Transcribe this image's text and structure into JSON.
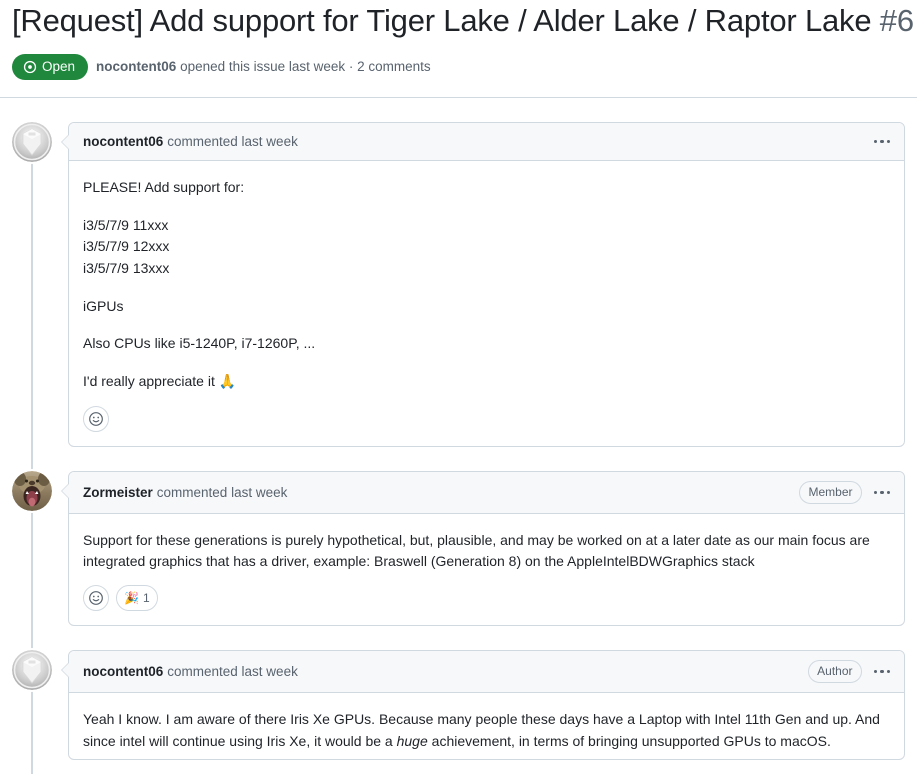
{
  "issue": {
    "title": "[Request] Add support for Tiger Lake / Alder Lake / Raptor Lake",
    "number": "#6",
    "state_label": "Open",
    "state_color": "#1f883d",
    "meta_author": "nocontent06",
    "meta_text": "opened this issue last week · 2 comments"
  },
  "comments": [
    {
      "author": "nocontent06",
      "action": "commented last week",
      "badge": "",
      "avatar": "default-avatar-icon",
      "body": {
        "p1": "PLEASE! Add support for:",
        "list": [
          "i3/5/7/9 11xxx",
          "i3/5/7/9 12xxx",
          "i3/5/7/9 13xxx"
        ],
        "p2": "iGPUs",
        "p3": "Also CPUs like i5-1240P, i7-1260P, ...",
        "p4": "I'd really appreciate it ",
        "p4_emoji": "🙏"
      },
      "reactions": []
    },
    {
      "author": "Zormeister",
      "action": "commented last week",
      "badge": "Member",
      "avatar": "photo-avatar-icon",
      "body": {
        "p1": "Support for these generations is purely hypothetical, but, plausible, and may be worked on at a later date as our main focus are integrated graphics that has a driver, example: Braswell (Generation 8) on the AppleIntelBDWGraphics stack"
      },
      "reactions": [
        {
          "emoji": "🎉",
          "count": "1"
        }
      ]
    },
    {
      "author": "nocontent06",
      "action": "commented last week",
      "badge": "Author",
      "avatar": "default-avatar-icon",
      "body": {
        "p1_a": "Yeah I know. I am aware of there Iris Xe GPUs. Because many people these days have a Laptop with Intel 11th Gen and up. And since intel will continue using Iris Xe, it would be a ",
        "p1_em": "huge",
        "p1_b": " achievement, in terms of bringing unsupported GPUs to macOS."
      },
      "reactions": []
    }
  ],
  "icons": {
    "issue_open": "issue-opened-icon",
    "kebab": "kebab-menu-icon",
    "add_reaction": "smiley-add-reaction-icon"
  }
}
